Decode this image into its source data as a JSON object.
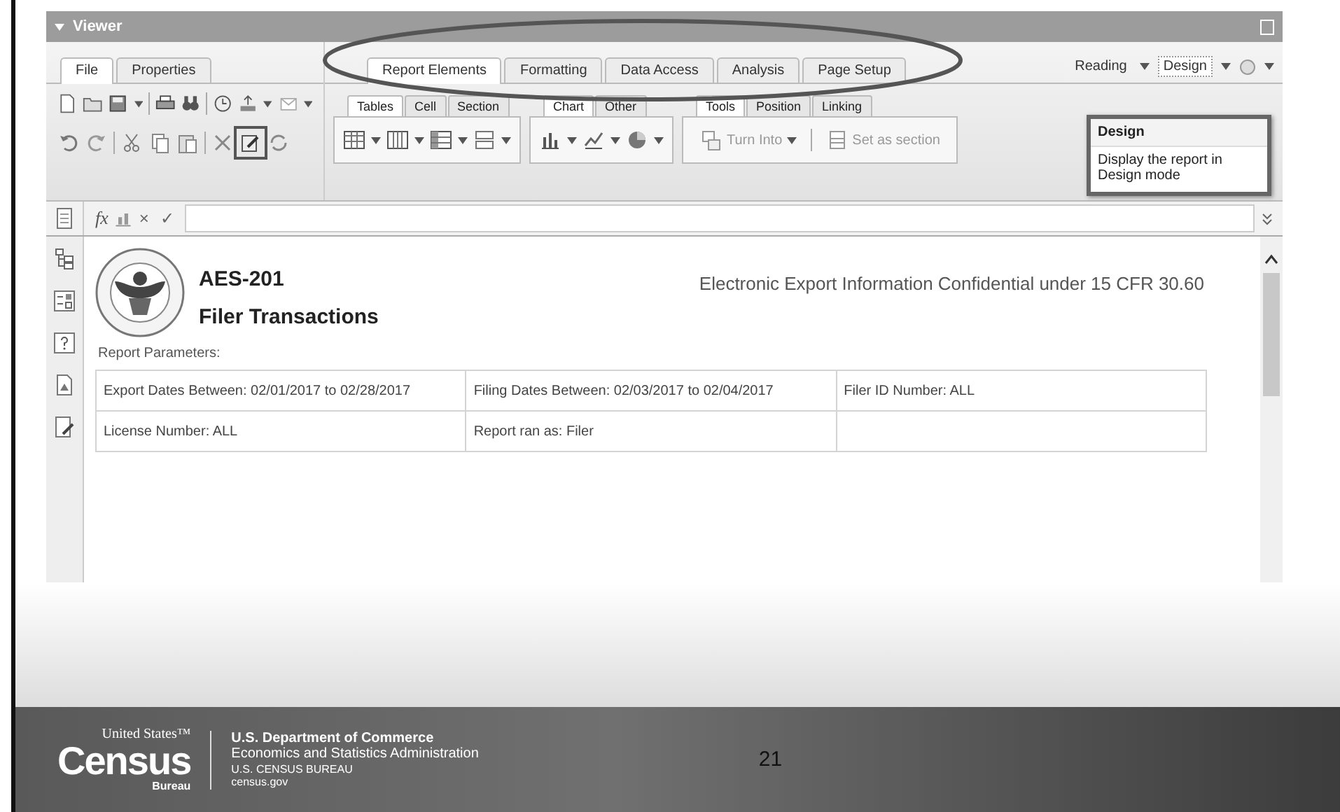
{
  "viewer": {
    "title": "Viewer"
  },
  "left_tabs": [
    {
      "label": "File",
      "selected": true
    },
    {
      "label": "Properties",
      "selected": false
    }
  ],
  "main_tabs": [
    {
      "label": "Report Elements",
      "selected": true
    },
    {
      "label": "Formatting",
      "selected": false
    },
    {
      "label": "Data Access",
      "selected": false
    },
    {
      "label": "Analysis",
      "selected": false
    },
    {
      "label": "Page Setup",
      "selected": false
    }
  ],
  "mode_buttons": [
    {
      "label": "Reading",
      "selected": false
    },
    {
      "label": "Design",
      "selected": true
    }
  ],
  "sub_tab_groups": [
    [
      {
        "label": "Tables",
        "selected": true
      },
      {
        "label": "Cell",
        "selected": false
      },
      {
        "label": "Section",
        "selected": false
      }
    ],
    [
      {
        "label": "Chart",
        "selected": true
      },
      {
        "label": "Other",
        "selected": false
      }
    ],
    [
      {
        "label": "Tools",
        "selected": true
      },
      {
        "label": "Position",
        "selected": false
      },
      {
        "label": "Linking",
        "selected": false
      }
    ]
  ],
  "tool_buttons": [
    {
      "label": "Turn Into",
      "disabled": true,
      "dropdown": true
    },
    {
      "label": "Set as section",
      "disabled": true,
      "dropdown": false
    }
  ],
  "tooltip": {
    "title": "Design",
    "text": "Display the report in Design mode"
  },
  "formula_bar": {
    "function": "fx",
    "cancel": "×",
    "accept": "✓"
  },
  "report": {
    "code": "AES-201",
    "title": "Filer Transactions",
    "notice": "Electronic Export Information Confidential under 15 CFR 30.60",
    "parameters_label": "Report Parameters:",
    "parameters": [
      [
        "Export Dates Between:  02/01/2017 to 02/28/2017",
        "Filing Dates Between:  02/03/2017 to 02/04/2017",
        "Filer ID Number: ALL"
      ],
      [
        "License Number: ALL",
        "Report ran as: Filer"
      ]
    ]
  },
  "footer": {
    "logo_top": "United States™",
    "logo_main": "Census",
    "logo_bottom": "Bureau",
    "lines": [
      "U.S. Department of Commerce",
      "Economics and Statistics Administration",
      "U.S. CENSUS BUREAU",
      "census.gov"
    ],
    "page_number": "21"
  }
}
